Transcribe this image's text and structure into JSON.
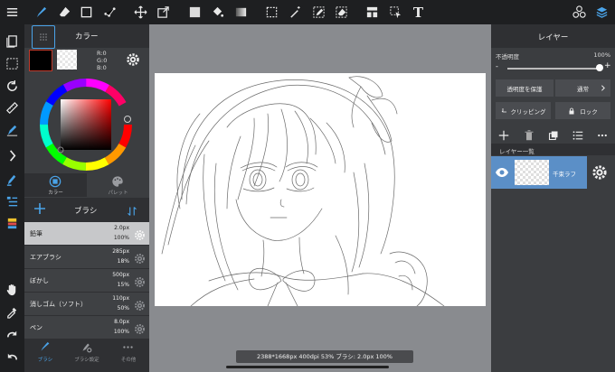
{
  "colors": {
    "accent": "#4aa3e8",
    "panel": "#3b3d40",
    "toolbar": "#1e1f21",
    "layer_selected": "#5b8fc7"
  },
  "toolbar": {
    "icons": [
      "menu-icon",
      "brush-icon",
      "eraser-icon",
      "rectangle-icon",
      "dot-line-icon",
      "move-icon",
      "transform-icon",
      "fill-color-icon",
      "bucket-icon",
      "gradient-icon",
      "select-icon",
      "magic-wand-icon",
      "select-pen-icon",
      "select-eraser-icon",
      "layout-icon",
      "select-move-icon",
      "text-icon",
      "materials-icon",
      "layers-icon"
    ],
    "text_tool": "T"
  },
  "color_panel": {
    "title": "カラー",
    "rgb": {
      "r": "R:0",
      "g": "G:0",
      "b": "B:0"
    },
    "tabs": [
      {
        "label": "カラー"
      },
      {
        "label": "パレット"
      }
    ]
  },
  "brush_panel": {
    "title": "ブラシ",
    "items": [
      {
        "name": "鉛筆",
        "size": "2.0px",
        "opacity": "100%",
        "selected": true
      },
      {
        "name": "エアブラシ",
        "size": "285px",
        "opacity": "18%",
        "selected": false
      },
      {
        "name": "ぼかし",
        "size": "500px",
        "opacity": "15%",
        "selected": false
      },
      {
        "name": "消しゴム（ソフト）",
        "size": "110px",
        "opacity": "50%",
        "selected": false
      },
      {
        "name": "ペン",
        "size": "8.0px",
        "opacity": "100%",
        "selected": false
      }
    ],
    "bottom_tabs": [
      {
        "label": "ブラシ"
      },
      {
        "label": "ブラシ設定"
      },
      {
        "label": "その他"
      }
    ]
  },
  "status": {
    "text": "2388*1668px 400dpi 53% ブラシ: 2.0px 100%"
  },
  "layer_panel": {
    "title": "レイヤー",
    "opacity_label": "不透明度",
    "opacity_value": "100%",
    "opacity_level": 1.0,
    "minus": "-",
    "plus": "+",
    "protect_alpha": "透明度を保護",
    "blend_mode": "通常",
    "clipping": "クリッピング",
    "lock": "ロック",
    "list_title": "レイヤー一覧",
    "layers": [
      {
        "name": "千束ラフ",
        "visible": true,
        "selected": true
      }
    ]
  }
}
